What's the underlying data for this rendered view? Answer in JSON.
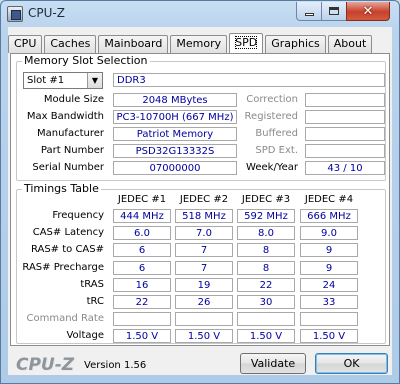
{
  "window": {
    "title": "CPU-Z"
  },
  "tabs": [
    "CPU",
    "Caches",
    "Mainboard",
    "Memory",
    "SPD",
    "Graphics",
    "About"
  ],
  "active_tab": "SPD",
  "slot_section": {
    "title": "Memory Slot Selection",
    "slot_value": "Slot #1",
    "memory_type": "DDR3",
    "labels": {
      "module_size": "Module Size",
      "max_bandwidth": "Max Bandwidth",
      "manufacturer": "Manufacturer",
      "part_number": "Part Number",
      "serial_number": "Serial Number",
      "correction": "Correction",
      "registered": "Registered",
      "buffered": "Buffered",
      "spd_ext": "SPD Ext.",
      "week_year": "Week/Year"
    },
    "values": {
      "module_size": "2048 MBytes",
      "max_bandwidth": "PC3-10700H (667 MHz)",
      "manufacturer": "Patriot Memory",
      "part_number": "PSD32G13332S",
      "serial_number": "07000000",
      "correction": "",
      "registered": "",
      "buffered": "",
      "spd_ext": "",
      "week_year": "43 / 10"
    }
  },
  "timings": {
    "title": "Timings Table",
    "columns": [
      "JEDEC #1",
      "JEDEC #2",
      "JEDEC #3",
      "JEDEC #4"
    ],
    "rows": [
      {
        "label": "Frequency",
        "values": [
          "444 MHz",
          "518 MHz",
          "592 MHz",
          "666 MHz"
        ]
      },
      {
        "label": "CAS# Latency",
        "values": [
          "6.0",
          "7.0",
          "8.0",
          "9.0"
        ]
      },
      {
        "label": "RAS# to CAS#",
        "values": [
          "6",
          "7",
          "8",
          "9"
        ]
      },
      {
        "label": "RAS# Precharge",
        "values": [
          "6",
          "7",
          "8",
          "9"
        ]
      },
      {
        "label": "tRAS",
        "values": [
          "16",
          "19",
          "22",
          "24"
        ]
      },
      {
        "label": "tRC",
        "values": [
          "22",
          "26",
          "30",
          "33"
        ]
      },
      {
        "label": "Command Rate",
        "values": [
          "",
          "",
          "",
          ""
        ],
        "disabled": true
      },
      {
        "label": "Voltage",
        "values": [
          "1.50 V",
          "1.50 V",
          "1.50 V",
          "1.50 V"
        ]
      }
    ]
  },
  "footer": {
    "logo": "CPU-Z",
    "version": "Version 1.56",
    "validate_label": "Validate",
    "ok_label": "OK"
  }
}
